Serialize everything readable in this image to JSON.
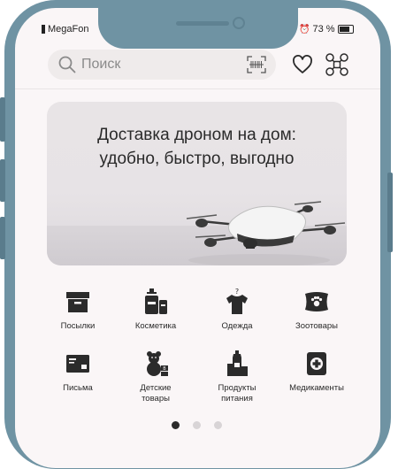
{
  "status_bar": {
    "carrier": "MegaFon",
    "battery_percent": "73 %"
  },
  "search": {
    "placeholder": "Поиск"
  },
  "banner": {
    "title_line1": "Доставка дроном на дом:",
    "title_line2": "удобно, быстро, выгодно"
  },
  "categories": [
    {
      "label": "Посылки",
      "icon": "box-icon"
    },
    {
      "label": "Косметика",
      "icon": "cosmetics-icon"
    },
    {
      "label": "Одежда",
      "icon": "tshirt-icon"
    },
    {
      "label": "Зоотовары",
      "icon": "pet-bed-icon"
    },
    {
      "label": "Письма",
      "icon": "letter-icon"
    },
    {
      "label": "Детские товары",
      "line1": "Детские",
      "line2": "товары",
      "icon": "teddy-bear-icon"
    },
    {
      "label": "Продукты питания",
      "line1": "Продукты",
      "line2": "питания",
      "icon": "groceries-icon"
    },
    {
      "label": "Медикаменты",
      "icon": "first-aid-icon"
    }
  ],
  "pagination": {
    "pages": 3,
    "current_page": 1
  },
  "colors": {
    "frame": "#6f93a3",
    "screen_bg": "#faf6f7",
    "icon_dark": "#2b2b2b",
    "dot_inactive": "#d8d4d6"
  }
}
